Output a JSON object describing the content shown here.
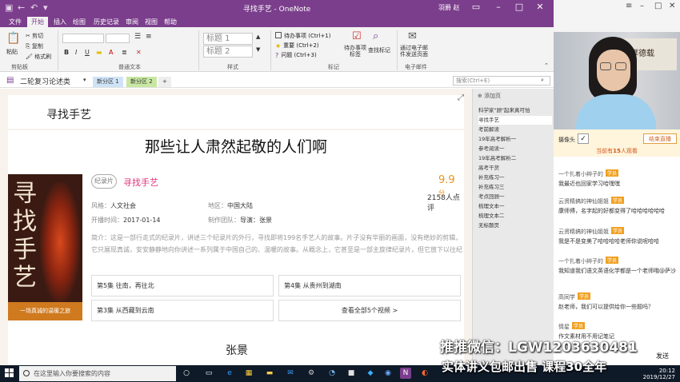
{
  "window": {
    "title": "寻找手艺 - OneNote",
    "user": "羽爵 赵"
  },
  "ribbon": {
    "tabs": [
      "文件",
      "开始",
      "插入",
      "绘图",
      "历史记录",
      "审阅",
      "视图",
      "帮助"
    ],
    "active_tab": "开始",
    "clipboard": {
      "paste": "粘贴",
      "cut": "剪切",
      "copy": "复制",
      "format_painter": "格式刷",
      "group": "剪贴板"
    },
    "text_group": "普通文本",
    "styles": {
      "heading1": "标题 1",
      "heading2": "标题 2",
      "group": "样式"
    },
    "tags": {
      "items": [
        "待办事项 (Ctrl+1)",
        "重要 (Ctrl+2)",
        "问题 (Ctrl+3)"
      ],
      "todo_tag": "待办事项\n标签",
      "find_tags": "查找标记",
      "group": "标记"
    },
    "email": {
      "send": "通过电子邮\n件发送页面",
      "group": "电子邮件"
    }
  },
  "notebook": {
    "name": "二轮复习论述类",
    "sections": [
      "新分区 1",
      "新分区 2"
    ],
    "add_section": "+",
    "search_placeholder": "搜索(Ctrl+E)"
  },
  "page": {
    "title": "寻找手艺",
    "headline": "那些让人肃然起敬的人们啊",
    "poster_text": "寻找手艺",
    "poster_band": "一场真诚的温暖之旅",
    "tag": "纪录片",
    "movie_name": "寻找手艺",
    "score": "9.9",
    "score_unit": "分",
    "raters": "2158人点评",
    "meta": {
      "style_label": "风格：",
      "style_value": "人文社会",
      "region_label": "地区：",
      "region_value": "中国大陆",
      "date_label": "开播时间：",
      "date_value": "2017-01-14",
      "team_label": "制作团队：",
      "team_value": "导演：张景"
    },
    "synopsis": "简介：这是一部行走式的纪录片，讲述三个纪录片的外行，寻找即将199名手艺人的故事。片子没有华丽的画面，没有绝妙的剪辑，它只展现真诚，安安静静地向你讲述一系列属于中国自己的、温暖的故事。从概念上，它甚至是一部主旋律纪录片，但它放下以往纪录片的高高在上，而是从个人情感...",
    "episodes": [
      "第5集 往南，再往北",
      "第4集 从贵州到湖南",
      "第3集 从西藏到云南",
      "查看全部5个视频 >"
    ],
    "bottom_title": "张景"
  },
  "pagelist": {
    "add": "添加页",
    "pages": [
      "科学家\"顾\"起来真可怕",
      "寻找手艺",
      "考前解读",
      "19年高考解析一",
      "参考阅读一",
      "19年高考解析二",
      "高考干货",
      "补充练习一",
      "补充练习三",
      "考点回顾一",
      "梳理文本一",
      "梳理文本二",
      "无标题页"
    ],
    "active_index": 1
  },
  "stream": {
    "camera_label": "摄像头",
    "camera_check": "✓",
    "end_button": "结束直播",
    "viewers_prefix": "当前有",
    "viewers_count": "15",
    "viewers_suffix": "人观看",
    "webcam_art": "厚德载",
    "chats": [
      {
        "name": "一个扎着小辫子的",
        "badge": "学员",
        "msg": "我最近也回家学习哈嘿嘿"
      },
      {
        "name": "云贤精搞的神仙姐姐",
        "badge": "学员",
        "msg": "康师傅，名字起的好都变得了哈哈哈哈哈哈"
      },
      {
        "name": "云贤精搞的神仙姐姐",
        "badge": "学员",
        "msg": "我是不是变美了哈哈哈哈老师你说呢哈哈"
      },
      {
        "name": "一个扎着小辫子的",
        "badge": "学员",
        "msg": "我知道我们语文英语化学都是一个老师哦@萨沙"
      },
      {
        "name": "高同学",
        "badge": "学员",
        "msg": "赵老师，我们可以提供给你一些题吗？"
      },
      {
        "name": "情星",
        "badge": "学员",
        "msg": "作文素材用不用记笔记"
      }
    ],
    "send": "发送"
  },
  "taskbar": {
    "search_placeholder": "在这里输入你要搜索的内容",
    "time": "20:12",
    "date": "2019/12/27"
  },
  "watermark": {
    "line1": "推推微信：LGW1203630481",
    "line2": "实体讲义包邮出售 课程30全年"
  }
}
